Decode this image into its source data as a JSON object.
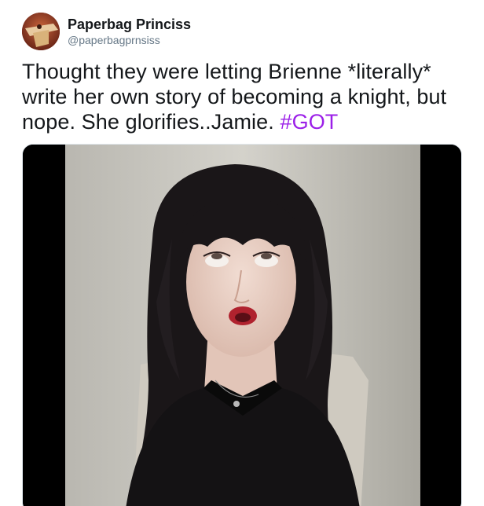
{
  "tweet": {
    "display_name": "Paperbag Princiss",
    "handle": "@paperbagprnsiss",
    "text_before": "Thought they were letting Brienne *literally* write her own story of becoming a knight, but nope. She glorifies..Jamie.",
    "hashtag": "#GOT"
  },
  "icons": {
    "avatar": "avatar-image",
    "media": "reaction-gif-image"
  },
  "colors": {
    "text": "#14171a",
    "secondary": "#657786",
    "hashtag": "#9b1fe8"
  }
}
